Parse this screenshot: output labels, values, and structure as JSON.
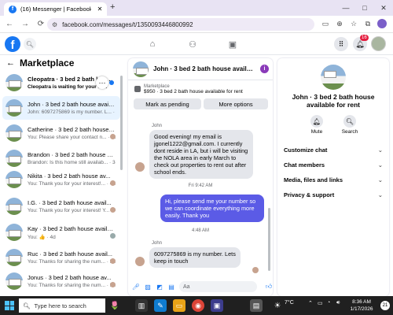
{
  "browser": {
    "tab_title": "(16) Messenger | Facebook",
    "tab_favicon": "f",
    "tab_close": "✕",
    "new_tab": "+",
    "url": "facebook.com/messages/t/1350093446800992",
    "win_min": "—",
    "win_max": "□",
    "win_close": "✕"
  },
  "fb_header": {
    "logo": "f",
    "notif_count": "16"
  },
  "marketplace": {
    "title": "Marketplace",
    "conversations": [
      {
        "name": "Cleopatra · 3 bed 2 bath house ...",
        "preview": "Cleopatra is waiting for your re...",
        "bold": true
      },
      {
        "name": "John · 3 bed 2 bath house availab...",
        "preview": "John: 6097275869 is my number. L... · 3h",
        "bold": false
      },
      {
        "name": "Catherine · 3 bed 2 bath house a...",
        "preview": "You: Please share your contact n... · 3d",
        "bold": false
      },
      {
        "name": "Brandon · 3 bed 2 bath house av...",
        "preview": "Brandon: Is this home still availab... · 3d",
        "bold": false
      },
      {
        "name": "Nikita · 3 bed 2 bath house av...",
        "preview": "You: Thank you for your interest!... · 4d",
        "bold": false
      },
      {
        "name": "I.G. · 3 bed 2 bath house avail...",
        "preview": "You: Thank you for your interest! Y... · 4d",
        "bold": false
      },
      {
        "name": "Kay · 3 bed 2 bath house availab...",
        "preview": "You: 👍 · 4d",
        "bold": false
      },
      {
        "name": "Ruc · 3 bed 2 bath house avail...",
        "preview": "You: Thanks for sharing the num... · 5d",
        "bold": false
      },
      {
        "name": "Jonus · 3 bed 2 bath house av...",
        "preview": "You: Thanks for sharing the num... · 5d",
        "bold": false
      }
    ]
  },
  "chat": {
    "title": "John · 3 bed 2 bath house available...",
    "listing_label": "Marketplace",
    "listing_price": "$950 · 3 bed 2 bath house available for rent",
    "mark_pending": "Mark as pending",
    "more_options": "More options",
    "sender1": "John",
    "msg1": "Good evening! my email is jgonel1222@gmail.com. I currently dont reside in LA, but i will be visiting the NOLA area in early March to check out properties to rent out after school ends.",
    "time1": "Fri 9:42 AM",
    "msg2": "Hi, please send me your number so we can coordinate everything more easily. Thank you",
    "time2": "4:48 AM",
    "sender2": "John",
    "msg3": "6097275869 is my number. Lets keep in touch",
    "composer_placeholder": "Aa"
  },
  "right_panel": {
    "title": "John · 3 bed 2 bath house available for rent",
    "mute": "Mute",
    "search": "Search",
    "rows": [
      "Customize chat",
      "Chat members",
      "Media, files and links",
      "Privacy & support"
    ]
  },
  "taskbar": {
    "search_placeholder": "Type here to search",
    "temp": "7°C",
    "time": "8:36 AM",
    "date": "1/17/2026",
    "notif": "21"
  }
}
